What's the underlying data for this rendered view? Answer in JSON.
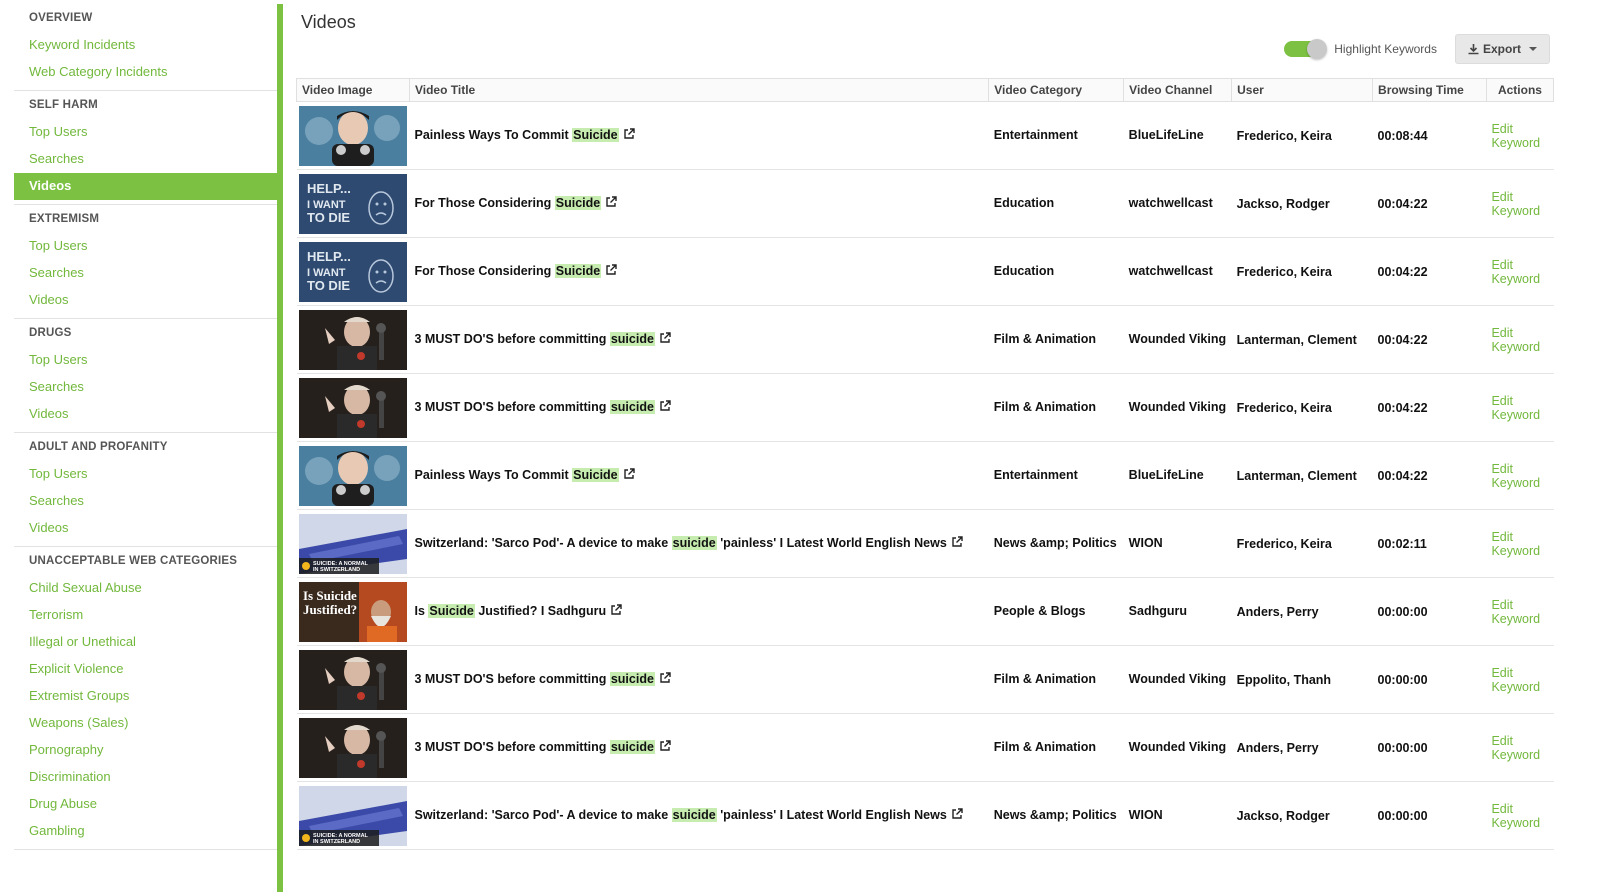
{
  "sidebar": {
    "sections": [
      {
        "title": "OVERVIEW",
        "items": [
          "Keyword Incidents",
          "Web Category Incidents"
        ]
      },
      {
        "title": "SELF HARM",
        "items": [
          "Top Users",
          "Searches",
          "Videos"
        ],
        "active": 2
      },
      {
        "title": "EXTREMISM",
        "items": [
          "Top Users",
          "Searches",
          "Videos"
        ]
      },
      {
        "title": "DRUGS",
        "items": [
          "Top Users",
          "Searches",
          "Videos"
        ]
      },
      {
        "title": "ADULT AND PROFANITY",
        "items": [
          "Top Users",
          "Searches",
          "Videos"
        ]
      },
      {
        "title": "UNACCEPTABLE WEB CATEGORIES",
        "items": [
          "Child Sexual Abuse",
          "Terrorism",
          "Illegal or Unethical",
          "Explicit Violence",
          "Extremist Groups",
          "Weapons (Sales)",
          "Pornography",
          "Discrimination",
          "Drug Abuse",
          "Gambling"
        ]
      }
    ]
  },
  "page": {
    "title": "Videos",
    "highlight_label": "Highlight Keywords",
    "export_label": "Export"
  },
  "table": {
    "headers": [
      "Video Image",
      "Video Title",
      "Video Category",
      "Video Channel",
      "User",
      "Browsing Time",
      "Actions"
    ],
    "rows": [
      {
        "thumb": "painless",
        "title_pre": "Painless Ways To Commit ",
        "kw": "Suicide",
        "title_post": "",
        "category": "Entertainment",
        "channel": "BlueLifeLine",
        "user": "Frederico, Keira",
        "time": "00:08:44",
        "action": "Edit Keyword"
      },
      {
        "thumb": "help",
        "title_pre": "For Those Considering ",
        "kw": "Suicide",
        "title_post": "",
        "category": "Education",
        "channel": "watchwellcast",
        "user": "Jackso, Rodger",
        "time": "00:04:22",
        "action": "Edit Keyword"
      },
      {
        "thumb": "help",
        "title_pre": "For Those Considering ",
        "kw": "Suicide",
        "title_post": "",
        "category": "Education",
        "channel": "watchwellcast",
        "user": "Frederico, Keira",
        "time": "00:04:22",
        "action": "Edit Keyword"
      },
      {
        "thumb": "viking",
        "title_pre": "3 MUST DO'S before committing ",
        "kw": "suicide",
        "title_post": "",
        "category": "Film & Animation",
        "channel": "Wounded Viking",
        "user": "Lanterman, Clement",
        "time": "00:04:22",
        "action": "Edit Keyword"
      },
      {
        "thumb": "viking",
        "title_pre": "3 MUST DO'S before committing ",
        "kw": "suicide",
        "title_post": "",
        "category": "Film & Animation",
        "channel": "Wounded Viking",
        "user": "Frederico, Keira",
        "time": "00:04:22",
        "action": "Edit Keyword"
      },
      {
        "thumb": "painless",
        "title_pre": "Painless Ways To Commit ",
        "kw": "Suicide",
        "title_post": "",
        "category": "Entertainment",
        "channel": "BlueLifeLine",
        "user": "Lanterman, Clement",
        "time": "00:04:22",
        "action": "Edit Keyword"
      },
      {
        "thumb": "sarco",
        "title_pre": "Switzerland: 'Sarco Pod'- A device to make ",
        "kw": "suicide",
        "title_post": " 'painless' I Latest World English News",
        "category": "News &amp; Politics",
        "channel": "WION",
        "user": "Frederico, Keira",
        "time": "00:02:11",
        "action": "Edit Keyword"
      },
      {
        "thumb": "sadhguru",
        "title_pre": "Is ",
        "kw": "Suicide",
        "title_post": " Justified? I Sadhguru",
        "category": "People & Blogs",
        "channel": "Sadhguru",
        "user": "Anders, Perry",
        "time": "00:00:00",
        "action": "Edit Keyword"
      },
      {
        "thumb": "viking",
        "title_pre": "3 MUST DO'S before committing ",
        "kw": "suicide",
        "title_post": "",
        "category": "Film & Animation",
        "channel": "Wounded Viking",
        "user": "Eppolito, Thanh",
        "time": "00:00:00",
        "action": "Edit Keyword"
      },
      {
        "thumb": "viking",
        "title_pre": "3 MUST DO'S before committing ",
        "kw": "suicide",
        "title_post": "",
        "category": "Film & Animation",
        "channel": "Wounded Viking",
        "user": "Anders, Perry",
        "time": "00:00:00",
        "action": "Edit Keyword"
      },
      {
        "thumb": "sarco",
        "title_pre": "Switzerland: 'Sarco Pod'- A device to make ",
        "kw": "suicide",
        "title_post": " 'painless' I Latest World English News",
        "category": "News &amp; Politics",
        "channel": "WION",
        "user": "Jackso, Rodger",
        "time": "00:00:00",
        "action": "Edit Keyword"
      }
    ]
  },
  "thumbs": {
    "help_text_1": "HELP...",
    "help_text_2": "I WANT",
    "help_text_3": "TO DIE",
    "sadhguru_text_1": "Is Suicide",
    "sadhguru_text_2": "Justified?",
    "sarco_text_1": "SUICIDE: A NORMAL",
    "sarco_text_2": "IN SWITZERLAND"
  },
  "colors": {
    "accent": "#7cc142",
    "link": "#72b83c",
    "highlight": "#c7ecb0"
  }
}
